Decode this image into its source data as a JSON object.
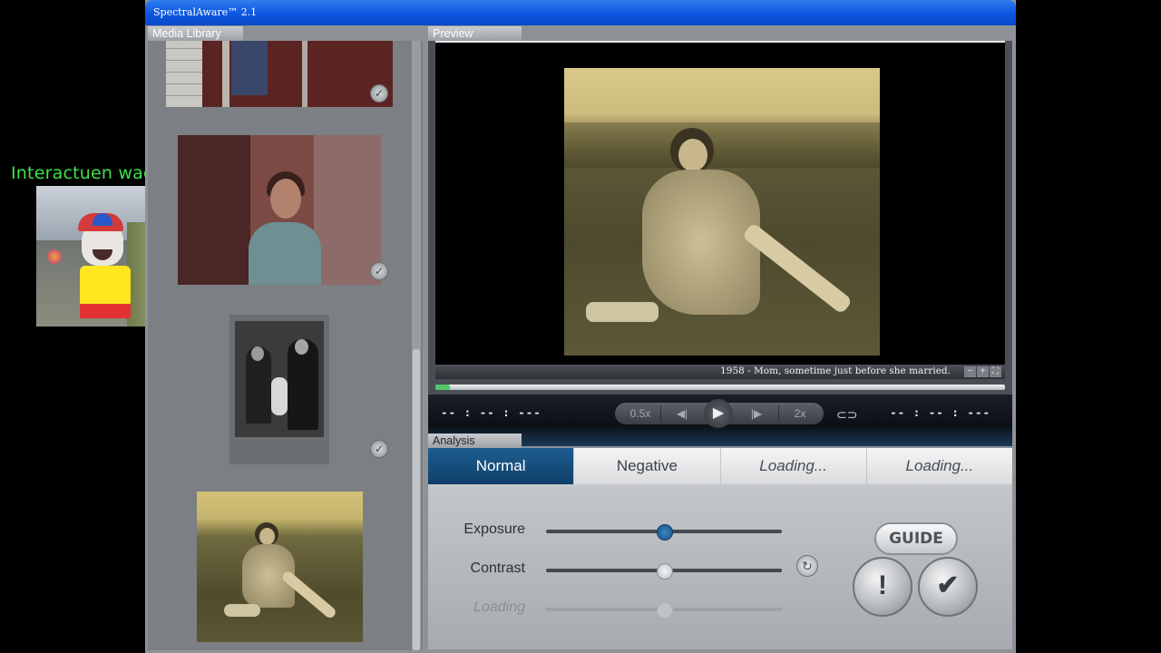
{
  "overlay": {
    "label": "Interactuen wacho"
  },
  "window": {
    "title": "SpectralAware™ 2.1"
  },
  "library": {
    "tab_label": "Media Library",
    "items": [
      {
        "name": "photo-1",
        "check": "✓"
      },
      {
        "name": "photo-2",
        "check": "✓"
      },
      {
        "name": "photo-3",
        "check": "✓"
      },
      {
        "name": "photo-4"
      }
    ]
  },
  "preview": {
    "tab_label": "Preview",
    "caption": "1958 - Mom, sometime just before she married.",
    "zoom_controls": [
      "−",
      "+",
      "⛶"
    ],
    "progress": 0.025,
    "time_left": "-- : -- : ---",
    "time_right": "-- : -- : ---",
    "transport": {
      "slow": "0.5x",
      "prev": "◀|",
      "play": "▶",
      "next": "|▶",
      "fast": "2x"
    },
    "loop_icon": "⊂⊃"
  },
  "analysis": {
    "tab_label": "Analysis",
    "modes": [
      {
        "label": "Normal",
        "state": "active"
      },
      {
        "label": "Negative",
        "state": "normal"
      },
      {
        "label": "Loading...",
        "state": "loading"
      },
      {
        "label": "Loading...",
        "state": "loading"
      }
    ],
    "sliders": [
      {
        "label": "Exposure",
        "value": 0.5,
        "style": "blue"
      },
      {
        "label": "Contrast",
        "value": 0.5,
        "style": "white"
      },
      {
        "label": "Loading",
        "value": 0.5,
        "style": "dim"
      }
    ],
    "reset_icon": "↻",
    "guide_label": "GUIDE",
    "warn_label": "!",
    "ok_label": "✔"
  }
}
